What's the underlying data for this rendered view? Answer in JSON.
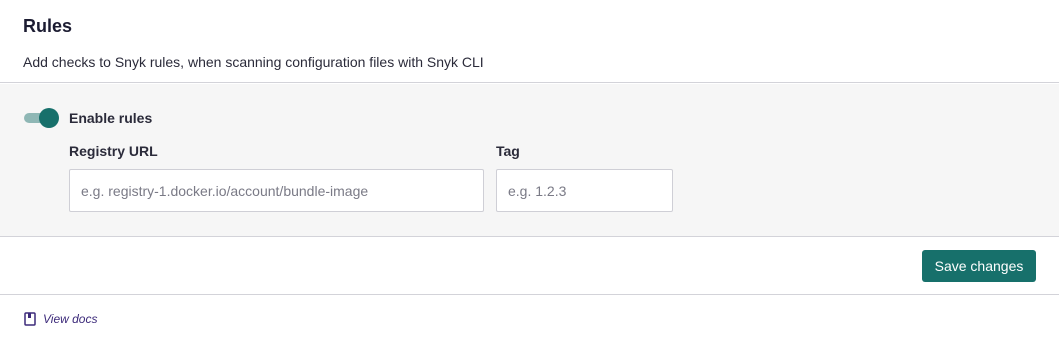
{
  "header": {
    "title": "Rules",
    "description": "Add checks to Snyk rules, when scanning configuration files with Snyk CLI"
  },
  "rules": {
    "enabled": true,
    "toggle_label": "Enable rules",
    "registry": {
      "label": "Registry URL",
      "value": "",
      "placeholder": "e.g. registry-1.docker.io/account/bundle-image"
    },
    "tag": {
      "label": "Tag",
      "value": "",
      "placeholder": "e.g. 1.2.3"
    }
  },
  "actions": {
    "save_label": "Save changes"
  },
  "docs": {
    "label": "View docs",
    "icon": "book-icon"
  },
  "colors": {
    "accent": "#17706b",
    "toggle_track": "#8fb7b5",
    "link": "#3c2a7a",
    "panel_bg": "#f6f6f6"
  }
}
